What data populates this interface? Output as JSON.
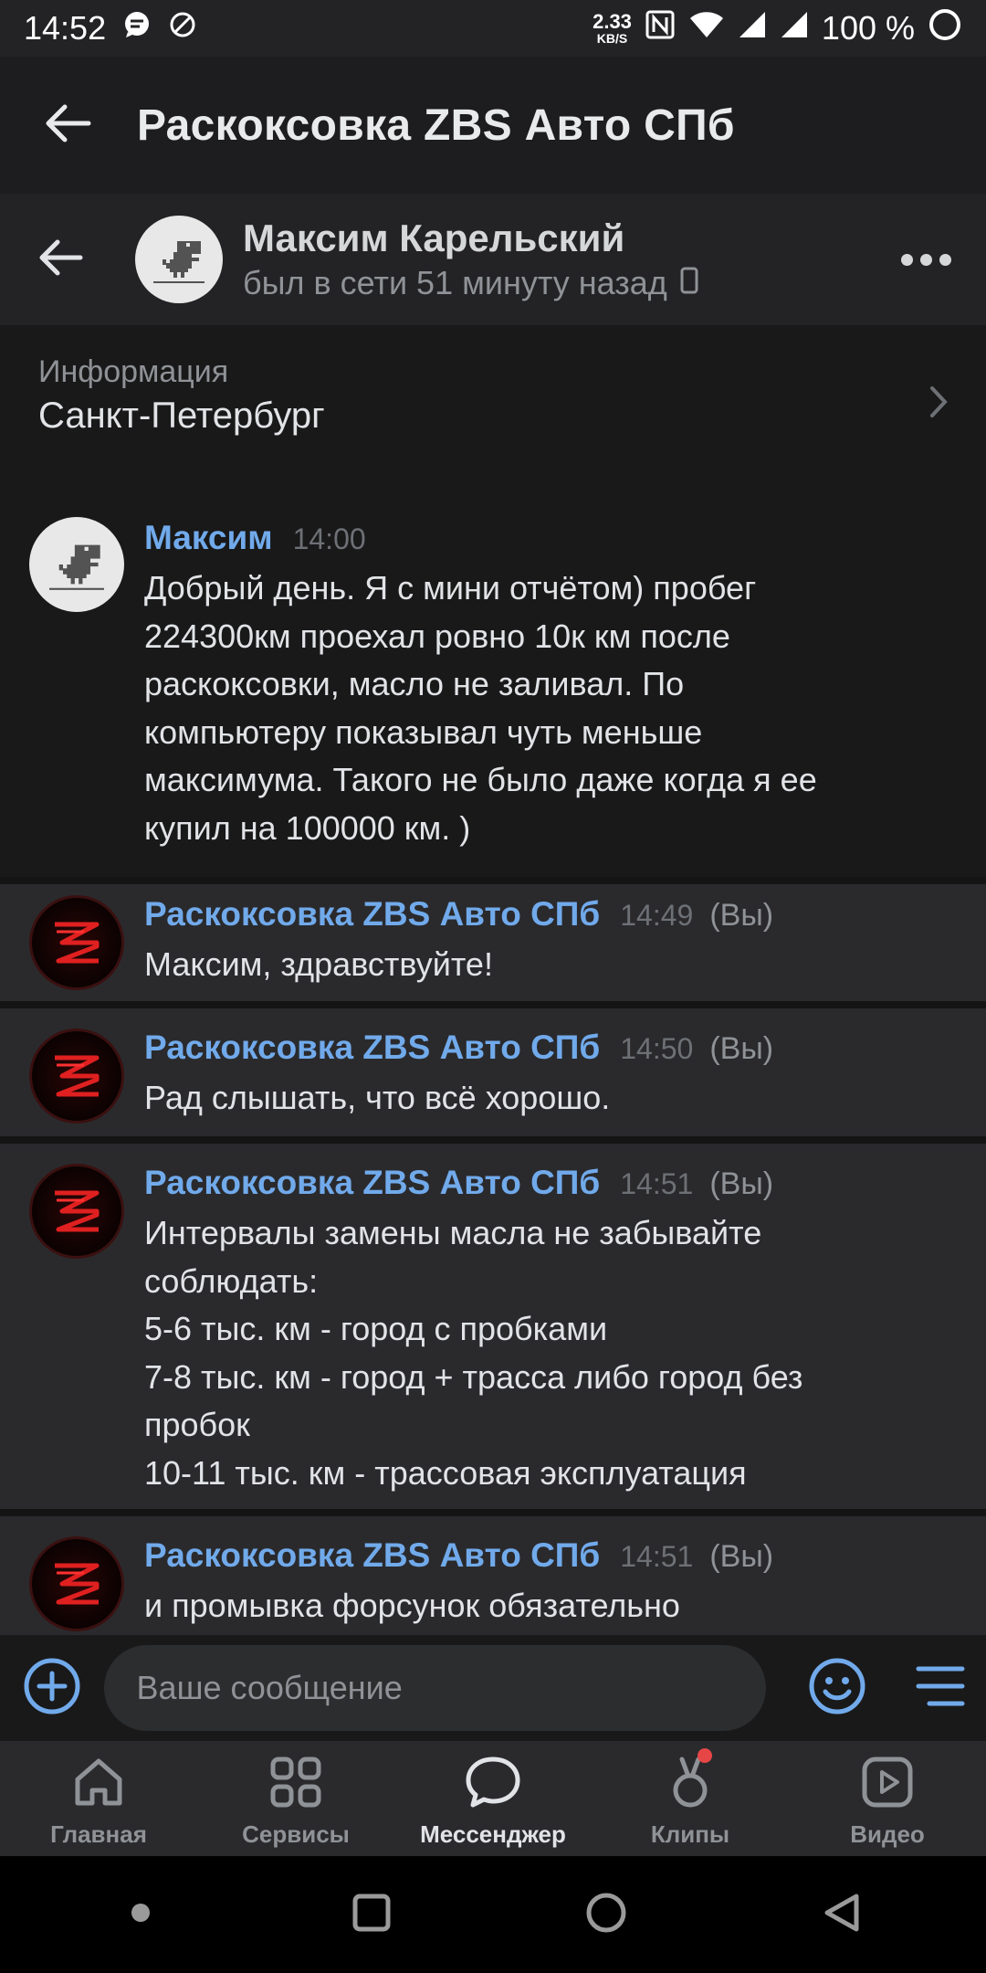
{
  "status_bar": {
    "time": "14:52",
    "speed_value": "2.33",
    "speed_unit": "KB/S",
    "battery": "100 %"
  },
  "app_header": {
    "title": "Раскоксовка ZBS Авто СПб"
  },
  "chat_header": {
    "name": "Максим Карельский",
    "last_seen": "был в сети 51 минуту назад"
  },
  "info": {
    "label": "Информация",
    "value": "Санкт-Петербург"
  },
  "messages": [
    {
      "author": "Максим",
      "time": "14:00",
      "you": "",
      "text": "Добрый день. Я с мини отчётом) пробег\n224300км проехал ровно 10к км после\nраскоксовки, масло не заливал. По\nкомпьютеру показывал чуть меньше\nмаксимума. Такого не было даже когда я ее\nкупил на 100000 км. )"
    },
    {
      "author": "Раскоксовка ZBS Авто СПб",
      "time": "14:49",
      "you": "(Вы)",
      "text": "Максим, здравствуйте!"
    },
    {
      "author": "Раскоксовка ZBS Авто СПб",
      "time": "14:50",
      "you": "(Вы)",
      "text": "Рад слышать, что всё хорошо."
    },
    {
      "author": "Раскоксовка ZBS Авто СПб",
      "time": "14:51",
      "you": "(Вы)",
      "text": "Интервалы замены масла не забывайте\nсоблюдать:\n5-6 тыс. км - город с пробками\n7-8 тыс. км - город + трасса либо город без\nпробок\n10-11 тыс. км - трассовая эксплуатация"
    },
    {
      "author": "Раскоксовка ZBS Авто СПб",
      "time": "14:51",
      "you": "(Вы)",
      "text": "и промывка форсунок обязательно"
    }
  ],
  "composer": {
    "placeholder": "Ваше сообщение"
  },
  "bottom_nav": [
    {
      "label": "Главная",
      "icon": "home-icon",
      "active": false
    },
    {
      "label": "Сервисы",
      "icon": "services-icon",
      "active": false
    },
    {
      "label": "Мессенджер",
      "icon": "messenger-icon",
      "active": true
    },
    {
      "label": "Клипы",
      "icon": "clips-icon",
      "active": false,
      "badge": true
    },
    {
      "label": "Видео",
      "icon": "video-icon",
      "active": false
    }
  ],
  "colors": {
    "accent": "#71aaeb",
    "background": "#19191a",
    "outgoing_background": "#2a2a2d",
    "badge": "#e64646"
  }
}
